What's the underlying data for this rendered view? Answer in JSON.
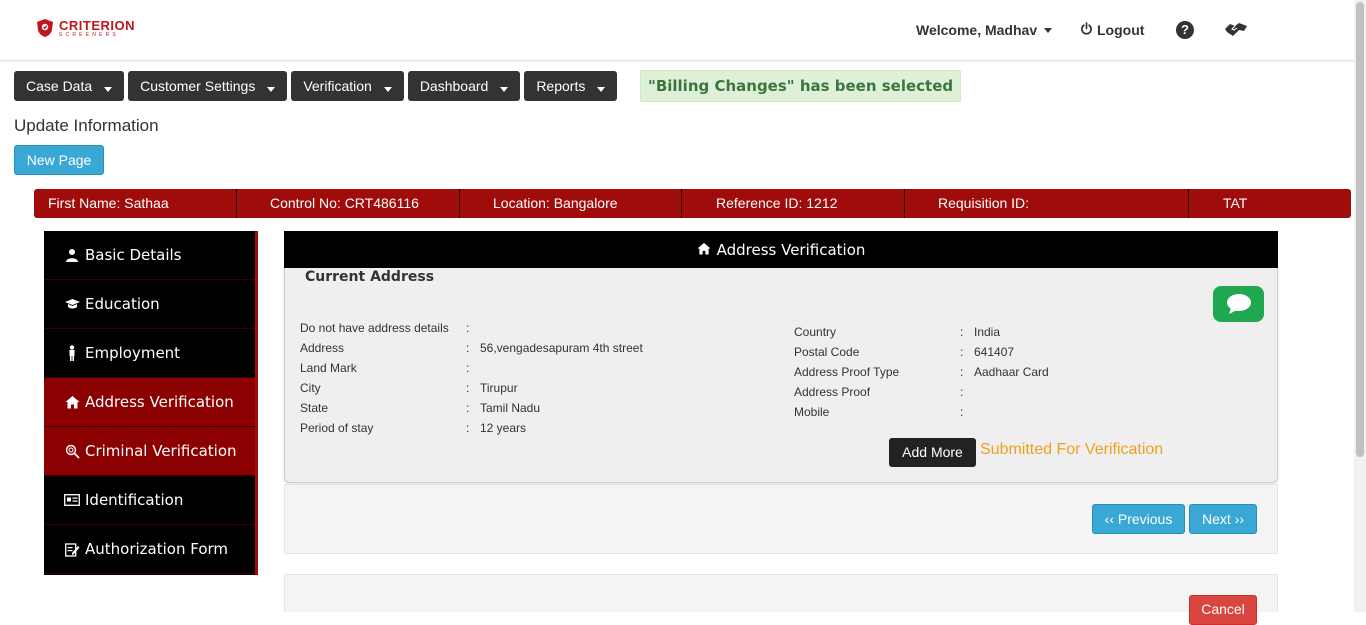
{
  "header": {
    "logo_main": "CRITERION",
    "logo_sub": "SCREENERS",
    "welcome": "Welcome, Madhav",
    "logout": "Logout",
    "help": "?"
  },
  "menu": [
    {
      "label": "Case Data"
    },
    {
      "label": "Customer Settings"
    },
    {
      "label": "Verification"
    },
    {
      "label": "Dashboard"
    },
    {
      "label": "Reports"
    }
  ],
  "selected_message": "\"Billing Changes\" has been selected",
  "page_title": "Update Information",
  "new_page_label": "New Page",
  "info_bar": {
    "first_name": "First Name: Sathaa",
    "control_no": "Control No: CRT486116",
    "location": "Location:  Bangalore",
    "reference_id": "Reference ID: 1212",
    "requisition_id": "Requisition ID:",
    "tat": "TAT"
  },
  "sidebar": [
    {
      "label": "Basic Details",
      "icon": "user-icon",
      "active": false
    },
    {
      "label": "Education",
      "icon": "graduation-cap-icon",
      "active": false
    },
    {
      "label": "Employment",
      "icon": "person-icon",
      "active": false
    },
    {
      "label": "Address Verification",
      "icon": "home-icon",
      "active": true
    },
    {
      "label": "Criminal Verification",
      "icon": "fingerprint-icon",
      "active": true
    },
    {
      "label": "Identification",
      "icon": "id-card-icon",
      "active": false
    },
    {
      "label": "Authorization Form",
      "icon": "edit-form-icon",
      "active": false
    }
  ],
  "panel": {
    "title": "Address Verification",
    "subtitle": "Current Address",
    "left_fields": [
      {
        "label": "Do not have address details",
        "value": ""
      },
      {
        "label": "Address",
        "value": "56,vengadesapuram 4th street"
      },
      {
        "label": "Land Mark",
        "value": ""
      },
      {
        "label": "City",
        "value": "Tirupur"
      },
      {
        "label": "State",
        "value": "Tamil Nadu"
      },
      {
        "label": "Period of stay",
        "value": "12 years"
      }
    ],
    "right_fields": [
      {
        "label": "Country",
        "value": "India"
      },
      {
        "label": "Postal Code",
        "value": "641407"
      },
      {
        "label": "Address Proof Type",
        "value": "Aadhaar Card"
      },
      {
        "label": "Address Proof",
        "value": ""
      },
      {
        "label": "Mobile",
        "value": ""
      }
    ],
    "add_more": "Add More",
    "status": "Submitted For Verification"
  },
  "nav": {
    "previous": "‹‹ Previous",
    "next": "Next ››"
  },
  "cancel_label": "Cancel",
  "colors": {
    "brand_red": "#a00b0b",
    "primary_blue": "#39a8d4",
    "status_orange": "#f0a020",
    "chat_green": "#1fa84f"
  }
}
